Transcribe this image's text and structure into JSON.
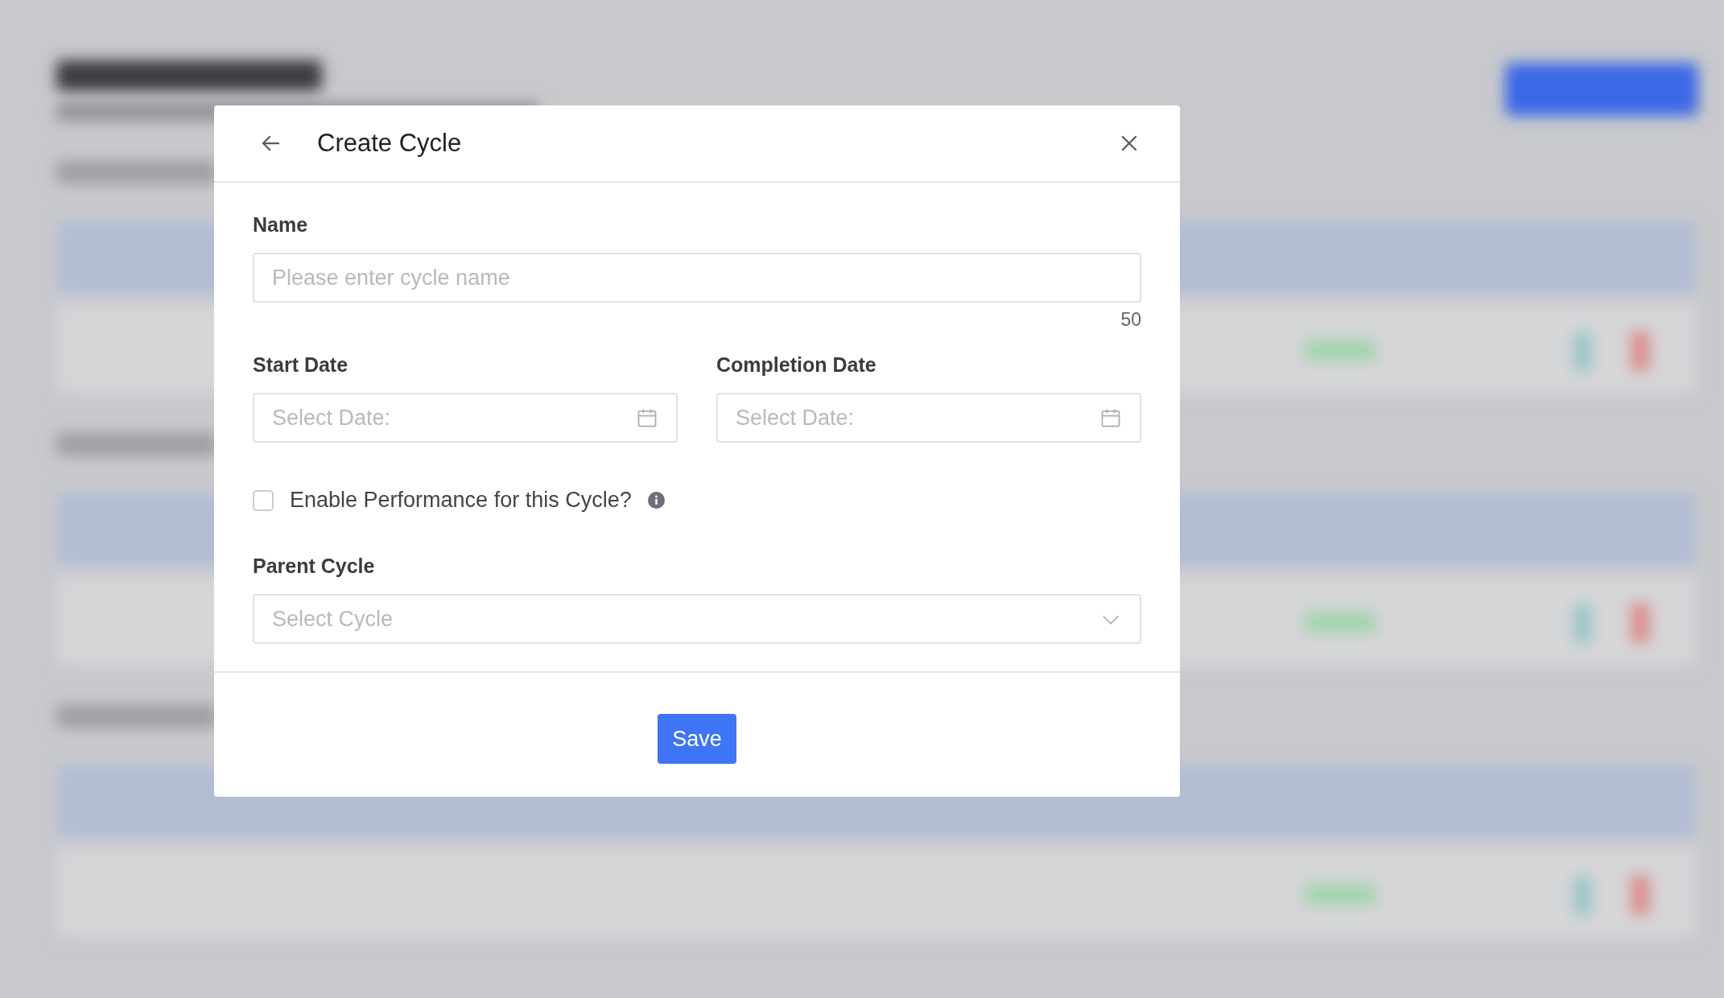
{
  "modal": {
    "title": "Create Cycle",
    "name_field": {
      "label": "Name",
      "placeholder": "Please enter cycle name",
      "counter": "50"
    },
    "date_fields": [
      {
        "label": "Start Date",
        "placeholder": "Select Date:"
      },
      {
        "label": "Completion Date",
        "placeholder": "Select Date:"
      }
    ],
    "performance_checkbox": {
      "label": "Enable Performance for this Cycle?",
      "checked": false
    },
    "parent_cycle": {
      "label": "Parent Cycle",
      "placeholder": "Select Cycle"
    },
    "save_button": "Save"
  }
}
